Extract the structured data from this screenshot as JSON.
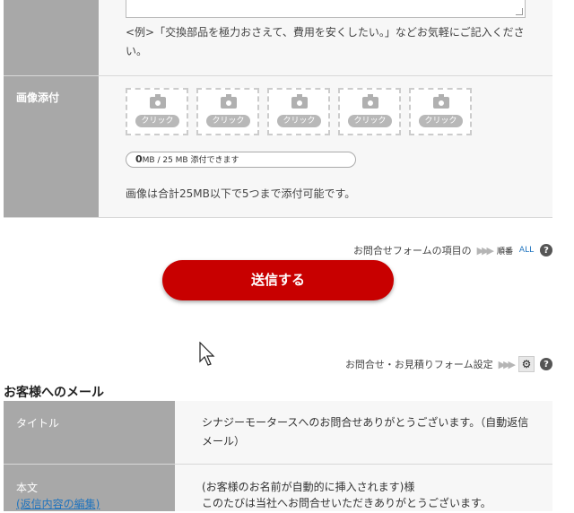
{
  "form": {
    "hint_text": "<例>「交換部品を極力おさえて、費用を安くしたい。」などお気軽にご記入ください。",
    "image_label": "画像添付",
    "slot_label": "クリック",
    "slots": [
      "クリック",
      "クリック",
      "クリック",
      "クリック",
      "クリック"
    ],
    "quota_used": "0",
    "quota_text": "MB / 25 MB 添付できます",
    "image_note": "画像は合計25MB以下で5つまで添付可能です。"
  },
  "order_row": {
    "label": "お問合せフォームの項目の",
    "arrows": "▶▶▶",
    "order_icon_label": "順番",
    "all_icon_label": "ALL"
  },
  "submit": {
    "label": "送信する"
  },
  "settings_row": {
    "label": "お問合せ・お見積りフォーム設定",
    "arrows": "▶▶▶"
  },
  "customer_mail": {
    "section_title": "お客様へのメール",
    "title_label": "タイトル",
    "title_value": "シナジーモータースへのお問合せありがとうございます。（自動返信メール）",
    "body_label": "本文",
    "body_edit_link": "(返信内容の編集)",
    "body_line1": "(お客様のお名前が自動的に挿入されます)様",
    "body_line2": "このたびは当社へお問合せいただきありがとうございます。"
  },
  "colors": {
    "sidebar": "#a8a8a8",
    "content_bg": "#f7f7f7",
    "submit": "#c80000",
    "link": "#1e73be"
  }
}
